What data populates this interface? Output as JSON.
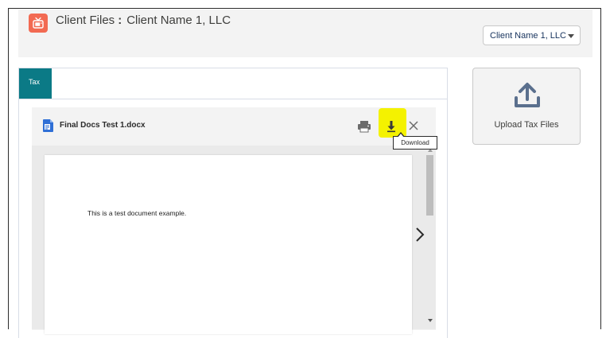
{
  "header": {
    "title": "Client Files",
    "separator": ":",
    "client_name": "Client Name 1, LLC",
    "icon": "tv-icon",
    "client_select": {
      "value": "Client Name 1, LLC"
    }
  },
  "tabs": [
    {
      "label": "Tax",
      "active": true
    }
  ],
  "file_viewer": {
    "file_name": "Final Docs Test 1.docx",
    "file_icon": "doc-icon",
    "actions": {
      "print": "print-icon",
      "download": "download-icon",
      "close": "close-icon"
    },
    "tooltip": "Download",
    "document_text": "This is a test document example."
  },
  "upload": {
    "label": "Upload Tax Files",
    "icon": "upload-icon"
  },
  "colors": {
    "tab_active": "#0b7a86",
    "app_icon": "#f26a52",
    "highlight": "#f4f200",
    "upload_icon": "#5a6f8d",
    "doc_icon": "#2f6fd6"
  }
}
